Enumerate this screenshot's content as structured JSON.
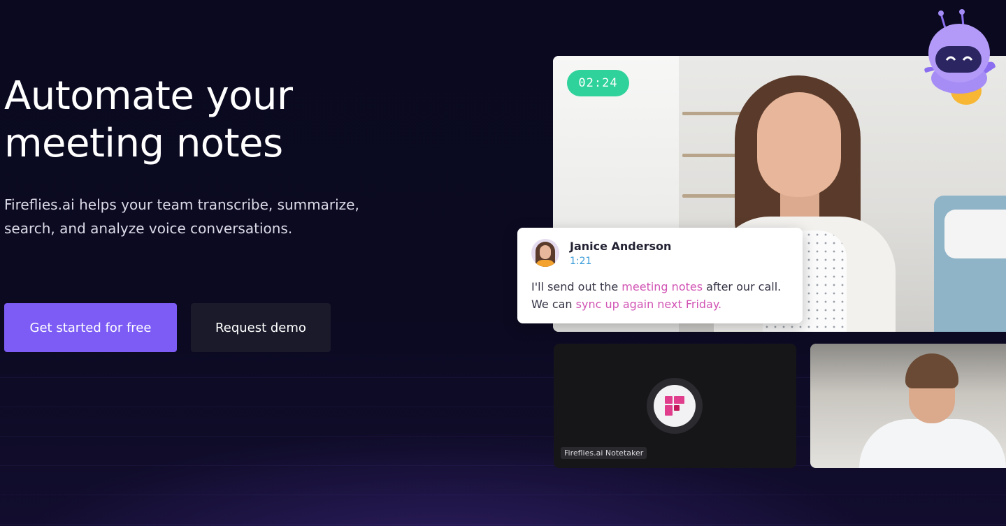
{
  "hero": {
    "headline": "Automate your meeting notes",
    "subtext": "Fireflies.ai helps your team transcribe, summarize, search, and analyze voice conversations."
  },
  "buttons": {
    "primary": "Get started for free",
    "secondary": "Request demo"
  },
  "meeting": {
    "timer": "02:24",
    "transcript": {
      "speaker": "Janice Anderson",
      "time": "1:21",
      "line1_pre": "I'll send out the ",
      "line1_highlight": "meeting notes",
      "line1_post": " after our call.",
      "line2_pre": "We can ",
      "line2_highlight": "sync up again next Friday."
    },
    "notetaker_label": "Fireflies.ai Notetaker"
  },
  "colors": {
    "background": "#0b0a1e",
    "primary_button": "#7c5cf5",
    "secondary_button": "#1a1a2b",
    "timer": "#2fd29a",
    "highlight": "#d154b4",
    "timestamp": "#3a9cd8"
  },
  "icons": {
    "mascot": "fireflies-robot-mascot",
    "logo": "fireflies-logo-icon"
  }
}
